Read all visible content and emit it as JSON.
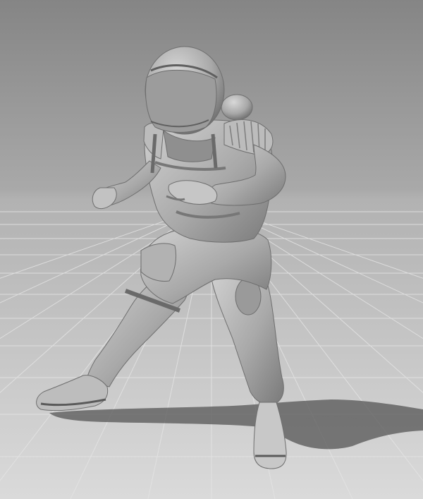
{
  "scene": {
    "subject_icon": "astronaut-figure-icon",
    "colors": {
      "backdrop_top": "#8a8a8a",
      "backdrop_bottom": "#b4b4b4",
      "floor_near": "#d2d2d2",
      "floor_far": "#b0b0b0",
      "grid_line": "#e6e6e6",
      "model_light": "#c9c9c9",
      "model_mid": "#a8a8a8",
      "model_dark": "#6f6f6f",
      "shadow": "#4a4a4a"
    }
  }
}
